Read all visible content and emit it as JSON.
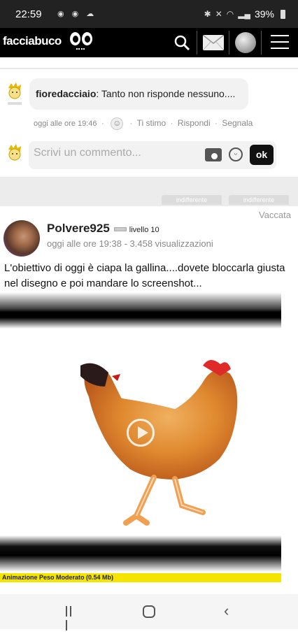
{
  "status": {
    "time": "22:59",
    "battery": "39%"
  },
  "header": {
    "logo": "facciabuco"
  },
  "comment": {
    "author": "fioredacciaio",
    "text": ": Tanto non risponde nessuno....",
    "time": "oggi alle ore 19:46",
    "like_label": "Ti stimo",
    "reply_label": "Rispondi",
    "report_label": "Segnala"
  },
  "compose": {
    "placeholder": "Scrivi un commento...",
    "send_label": "ok"
  },
  "reactions": {
    "left_label": "indifferente",
    "right_label": "indifferente"
  },
  "post": {
    "tag": "Vaccata",
    "author": "Polvere925",
    "level": "livello 10",
    "meta": "oggi alle ore 19:38 - 3.458 visualizzazioni",
    "text": "L'obiettivo di oggi è ciapa la gallina....dovete bloccarla giusta nel disegno e poi mandare lo screenshot...",
    "media_caption": "Animazione Peso Moderato (0.54 Mb)"
  },
  "icons": {
    "search": "search-icon",
    "mail": "mail-icon",
    "globe": "globe-icon",
    "menu": "menu-icon",
    "camera": "camera-icon",
    "emoji": "smiley-icon",
    "play": "play-icon"
  }
}
